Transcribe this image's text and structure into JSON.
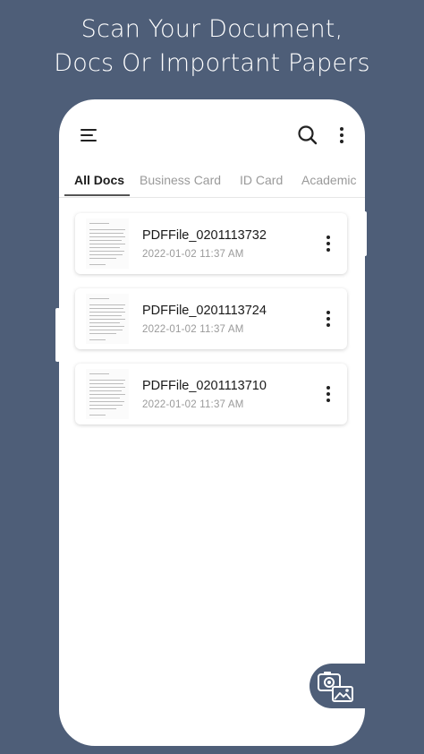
{
  "promo": {
    "line1": "Scan Your Document,",
    "line2": "Docs Or Important Papers"
  },
  "header": {
    "menu_icon": "hamburger-menu-icon",
    "search_icon": "search-icon",
    "more_icon": "more-vert-icon"
  },
  "tabs": [
    {
      "label": "All Docs",
      "active": true
    },
    {
      "label": "Business Card",
      "active": false
    },
    {
      "label": "ID Card",
      "active": false
    },
    {
      "label": "Academic",
      "active": false
    }
  ],
  "documents": [
    {
      "name": "PDFFile_0201113732",
      "date": "2022-01-02  11:37 AM"
    },
    {
      "name": "PDFFile_0201113724",
      "date": "2022-01-02  11:37 AM"
    },
    {
      "name": "PDFFile_0201113710",
      "date": "2022-01-02  11:37 AM"
    }
  ],
  "fab": {
    "icon": "camera-gallery-icon"
  },
  "colors": {
    "background": "#4e5e78",
    "surface": "#ffffff",
    "text_primary": "#1a1a1a",
    "text_secondary": "#9a9a9a"
  }
}
